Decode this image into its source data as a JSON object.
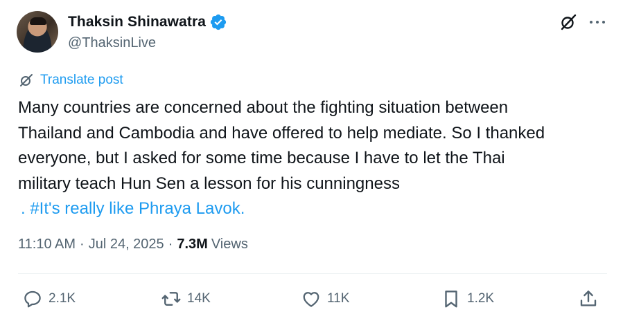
{
  "author": {
    "display_name": "Thaksin Shinawatra",
    "handle": "@ThaksinLive",
    "verified": true
  },
  "translate_label": "Translate post",
  "post_lines": [
    "Many countries are concerned about the fighting situation between",
    "Thailand and Cambodia and have offered to help mediate. So I thanked",
    "everyone, but I asked for some time because I have to let the Thai",
    "military teach Hun Sen a lesson for his cunningness"
  ],
  "post_hashtag_line": ". #It's really like Phraya Lavok.",
  "meta": {
    "time": "11:10 AM",
    "date": "Jul 24, 2025",
    "separator": "·",
    "views_count": "7.3M",
    "views_label": "Views"
  },
  "actions": {
    "replies": "2.1K",
    "reposts": "14K",
    "likes": "11K",
    "bookmarks": "1.2K"
  },
  "colors": {
    "accent": "#1d9bf0",
    "secondary_text": "#536471",
    "primary_text": "#0f1419",
    "divider": "#eff3f4"
  },
  "icons": [
    "verified-badge-icon",
    "grok-icon",
    "more-icon",
    "translate-icon",
    "reply-icon",
    "repost-icon",
    "like-icon",
    "bookmark-icon",
    "share-icon"
  ]
}
